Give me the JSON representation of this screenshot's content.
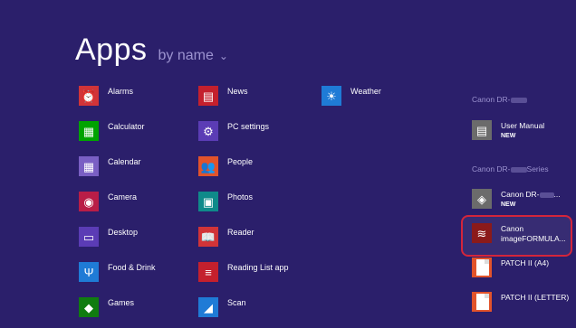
{
  "header": {
    "title": "Apps",
    "sort_label": "by name",
    "sort_chevron": "⌄"
  },
  "columns": [
    [
      {
        "label": "Alarms",
        "icon": "alarm-clock-icon",
        "color": "#d13438",
        "glyph": "⏰"
      },
      {
        "label": "Calculator",
        "icon": "calculator-icon",
        "color": "#00a300",
        "glyph": "▦"
      },
      {
        "label": "Calendar",
        "icon": "calendar-icon",
        "color": "#7a5fc4",
        "glyph": "▦"
      },
      {
        "label": "Camera",
        "icon": "camera-icon",
        "color": "#b91d47",
        "glyph": "◉"
      },
      {
        "label": "Desktop",
        "icon": "desktop-icon",
        "color": "#5b3cb5",
        "glyph": "▭"
      },
      {
        "label": "Food & Drink",
        "icon": "food-drink-icon",
        "color": "#1f7bd6",
        "glyph": "Ψ"
      },
      {
        "label": "Games",
        "icon": "games-icon",
        "color": "#107c10",
        "glyph": "◆"
      }
    ],
    [
      {
        "label": "News",
        "icon": "news-icon",
        "color": "#c4202d",
        "glyph": "▤"
      },
      {
        "label": "PC settings",
        "icon": "gear-icon",
        "color": "#5b3cb5",
        "glyph": "⚙"
      },
      {
        "label": "People",
        "icon": "people-icon",
        "color": "#e2532b",
        "glyph": "👥"
      },
      {
        "label": "Photos",
        "icon": "photos-icon",
        "color": "#0f8a8a",
        "glyph": "▣"
      },
      {
        "label": "Reader",
        "icon": "reader-icon",
        "color": "#d13438",
        "glyph": "📖"
      },
      {
        "label": "Reading List app",
        "icon": "reading-list-icon",
        "color": "#c4202d",
        "glyph": "≡"
      },
      {
        "label": "Scan",
        "icon": "scan-icon",
        "color": "#1f7bd6",
        "glyph": "◢"
      }
    ],
    [
      {
        "label": "Weather",
        "icon": "weather-sun-icon",
        "color": "#1f7bd6",
        "glyph": "☀"
      }
    ]
  ],
  "groups": [
    {
      "header": "Canon DR-",
      "items": [
        {
          "label": "User Manual",
          "new": "NEW",
          "icon": "manual-document-icon",
          "color": "#6b6b6b",
          "glyph": "▤"
        }
      ]
    },
    {
      "header": "Canon DR-",
      "header_suffix": "Series",
      "items": [
        {
          "label": "Canon DR-",
          "label_suffix": "...",
          "new": "NEW",
          "icon": "canon-scanner-icon",
          "color": "#6b6b6b",
          "glyph": "◈"
        },
        {
          "label": "Canon",
          "label2": "imageFORMULA...",
          "icon": "imageformula-icon",
          "color": "#8b1a1a",
          "glyph": "≋",
          "highlighted": true
        },
        {
          "label": "PATCH II (A4)",
          "icon": "patch-a4-doc-icon",
          "color": "#e2532b",
          "glyph": "doc"
        },
        {
          "label": "PATCH II (LETTER)",
          "icon": "patch-letter-doc-icon",
          "color": "#e2532b",
          "glyph": "doc"
        }
      ]
    }
  ]
}
